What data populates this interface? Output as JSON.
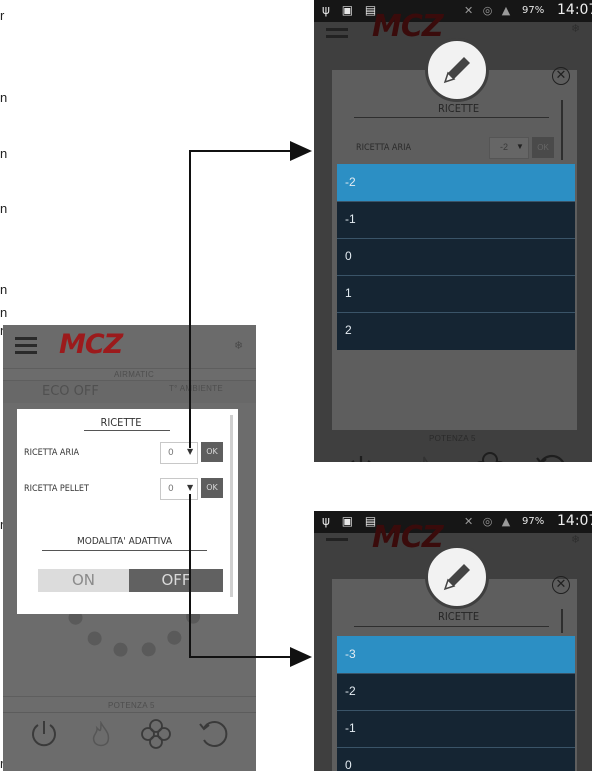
{
  "left_edge_chars": [
    "r",
    "n",
    "n",
    "n",
    "n",
    "n",
    "n",
    "n",
    "r"
  ],
  "left_phone": {
    "app_logo": "MCZ",
    "section_label": "AIRMATIC",
    "eco_label": "ECO OFF",
    "temp_label": "T° AMBIENTE",
    "bottom_label": "POTENZA 5",
    "dialog": {
      "title": "RICETTE",
      "rows": [
        {
          "label": "RICETTA ARIA",
          "value": "0",
          "ok": "OK"
        },
        {
          "label": "RICETTA PELLET",
          "value": "0",
          "ok": "OK"
        }
      ],
      "adaptive_title": "MODALITA' ADATTIVA",
      "toggle_on": "ON",
      "toggle_off": "OFF",
      "toggle_selected": "OFF"
    },
    "nav_icons": [
      "power-icon",
      "flame-icon",
      "fan-icon",
      "refresh-icon"
    ]
  },
  "right_top": {
    "status_time": "14:07",
    "battery": "97%",
    "app_logo": "MCZ",
    "dialog_title": "RICETTE",
    "row_label": "RICETTA ARIA",
    "row_value": "-2",
    "row_ok": "OK",
    "options": [
      "-2",
      "-1",
      "0",
      "1",
      "2"
    ],
    "selected_option": "-2",
    "bottom_label": "POTENZA 5"
  },
  "right_bottom": {
    "status_time": "14:07",
    "battery": "97%",
    "app_logo": "MCZ",
    "dialog_title": "RICETTE",
    "options": [
      "-3",
      "-2",
      "-1",
      "0"
    ],
    "selected_option": "-3"
  },
  "colors": {
    "highlight": "#2c8fc4",
    "list_bg": "#152533",
    "logo_red": "#9c1a1c",
    "arrow": "#111111"
  }
}
